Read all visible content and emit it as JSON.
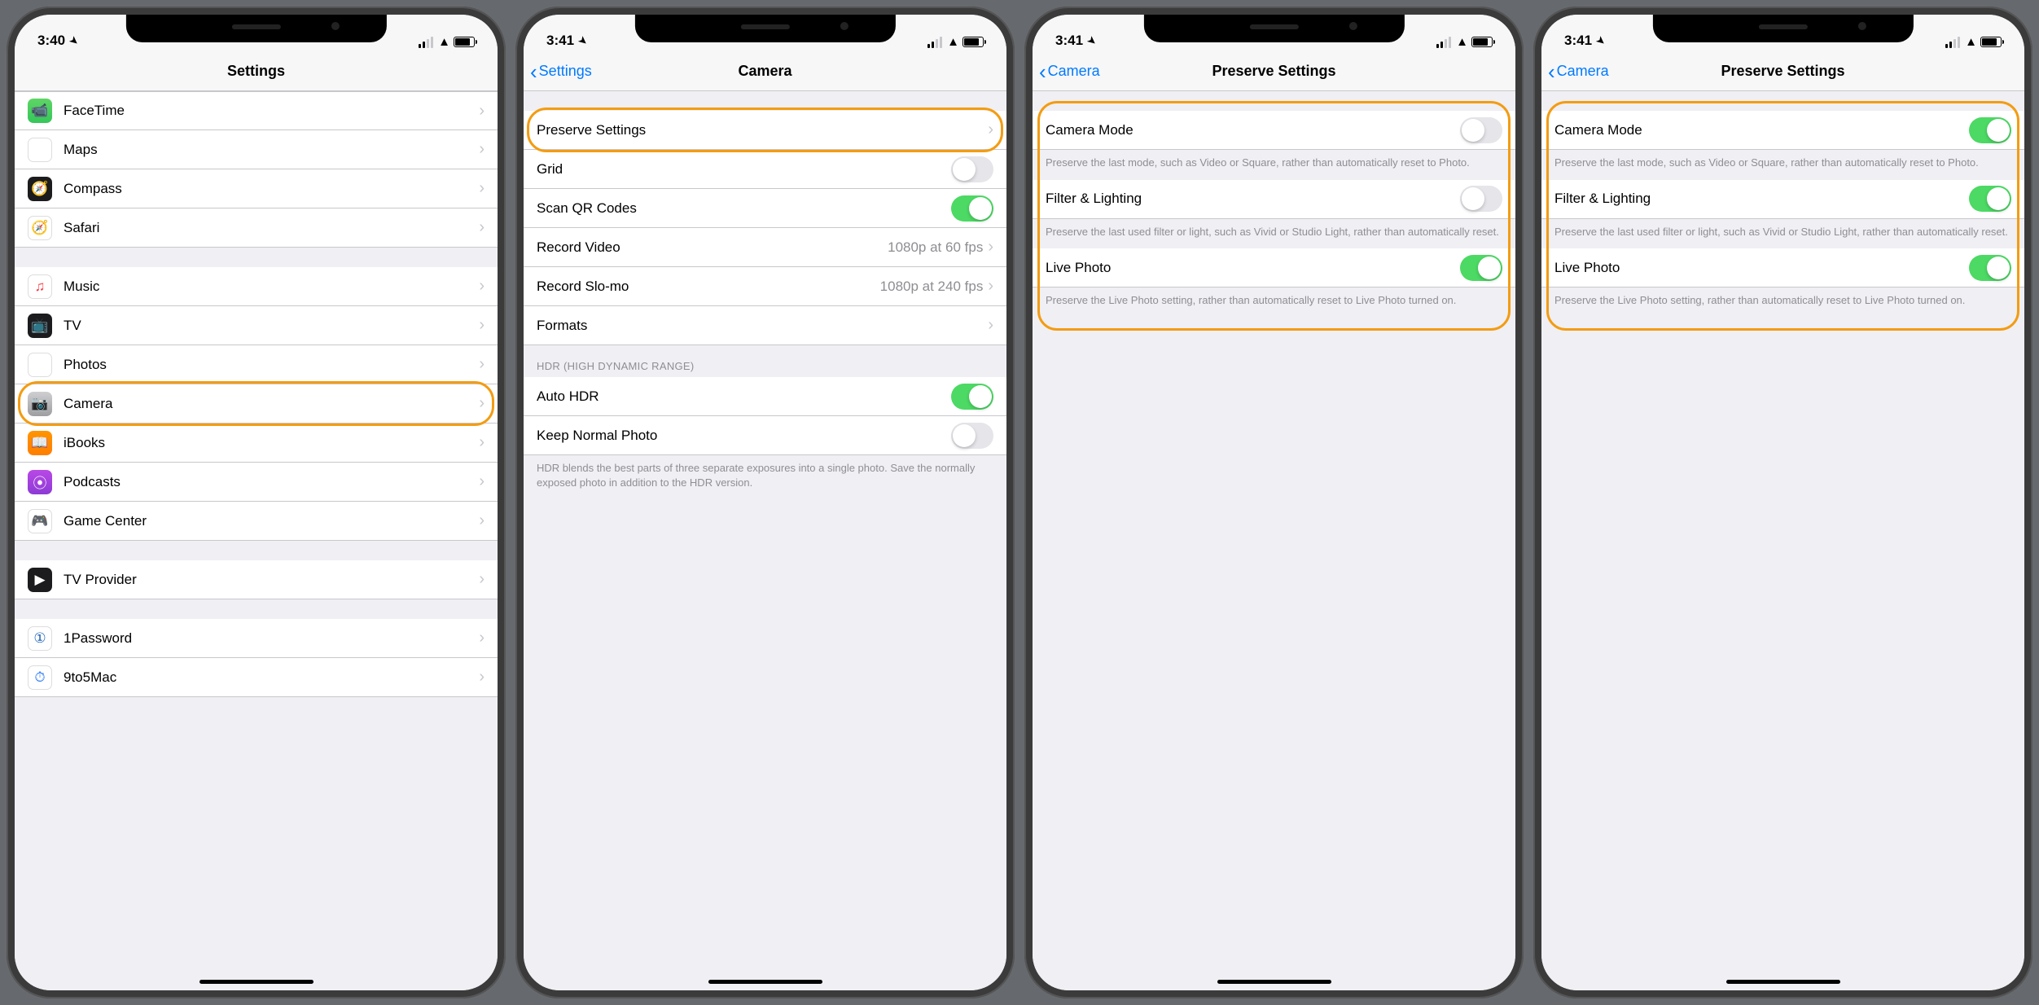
{
  "status": {
    "time1": "3:40",
    "time2": "3:41"
  },
  "screens": {
    "settings": {
      "title": "Settings",
      "groups": [
        {
          "items": [
            {
              "id": "facetime",
              "label": "FaceTime",
              "iconCls": "ic-facetime",
              "glyph": "📹"
            },
            {
              "id": "maps",
              "label": "Maps",
              "iconCls": "ic-maps",
              "glyph": "🗺"
            },
            {
              "id": "compass",
              "label": "Compass",
              "iconCls": "ic-compass",
              "glyph": "🧭"
            },
            {
              "id": "safari",
              "label": "Safari",
              "iconCls": "ic-safari",
              "glyph": "🧭"
            }
          ]
        },
        {
          "items": [
            {
              "id": "music",
              "label": "Music",
              "iconCls": "ic-music",
              "glyph": "♫"
            },
            {
              "id": "tv",
              "label": "TV",
              "iconCls": "ic-tv",
              "glyph": "📺"
            },
            {
              "id": "photos",
              "label": "Photos",
              "iconCls": "ic-photos",
              "glyph": "✿"
            },
            {
              "id": "camera",
              "label": "Camera",
              "iconCls": "ic-camera",
              "glyph": "📷",
              "highlight": true
            },
            {
              "id": "ibooks",
              "label": "iBooks",
              "iconCls": "ic-ibooks",
              "glyph": "📖"
            },
            {
              "id": "podcasts",
              "label": "Podcasts",
              "iconCls": "ic-podcasts",
              "glyph": "⦿"
            },
            {
              "id": "gamecenter",
              "label": "Game Center",
              "iconCls": "ic-gamecenter",
              "glyph": "🎮"
            }
          ]
        },
        {
          "items": [
            {
              "id": "tvprovider",
              "label": "TV Provider",
              "iconCls": "ic-tvprov",
              "glyph": "▶"
            }
          ]
        },
        {
          "items": [
            {
              "id": "onepassword",
              "label": "1Password",
              "iconCls": "ic-onepass",
              "glyph": "①"
            },
            {
              "id": "ninetofive",
              "label": "9to5Mac",
              "iconCls": "ic-ninetofive",
              "glyph": "⏱"
            }
          ]
        }
      ]
    },
    "camera": {
      "back": "Settings",
      "title": "Camera",
      "rows": {
        "preserve": {
          "label": "Preserve Settings",
          "type": "disclosure",
          "highlight": true
        },
        "grid": {
          "label": "Grid",
          "type": "switch",
          "on": false
        },
        "qr": {
          "label": "Scan QR Codes",
          "type": "switch",
          "on": true
        },
        "video": {
          "label": "Record Video",
          "type": "detail",
          "value": "1080p at 60 fps"
        },
        "slomo": {
          "label": "Record Slo-mo",
          "type": "detail",
          "value": "1080p at 240 fps"
        },
        "formats": {
          "label": "Formats",
          "type": "disclosure"
        }
      },
      "hdr": {
        "header": "HDR (HIGH DYNAMIC RANGE)",
        "auto": {
          "label": "Auto HDR",
          "on": true
        },
        "keep": {
          "label": "Keep Normal Photo",
          "on": false
        },
        "footer": "HDR blends the best parts of three separate exposures into a single photo. Save the normally exposed photo in addition to the HDR version."
      }
    },
    "preserve": {
      "back": "Camera",
      "title": "Preserve Settings",
      "rows": {
        "mode": {
          "label": "Camera Mode",
          "desc": "Preserve the last mode, such as Video or Square, rather than automatically reset to Photo."
        },
        "filter": {
          "label": "Filter & Lighting",
          "desc": "Preserve the last used filter or light, such as Vivid or Studio Light, rather than automatically reset."
        },
        "live": {
          "label": "Live Photo",
          "desc": "Preserve the Live Photo setting, rather than automatically reset to Live Photo turned on."
        }
      }
    },
    "preserve_states": {
      "a": {
        "mode": false,
        "filter": false,
        "live": true
      },
      "b": {
        "mode": true,
        "filter": true,
        "live": true
      }
    }
  }
}
